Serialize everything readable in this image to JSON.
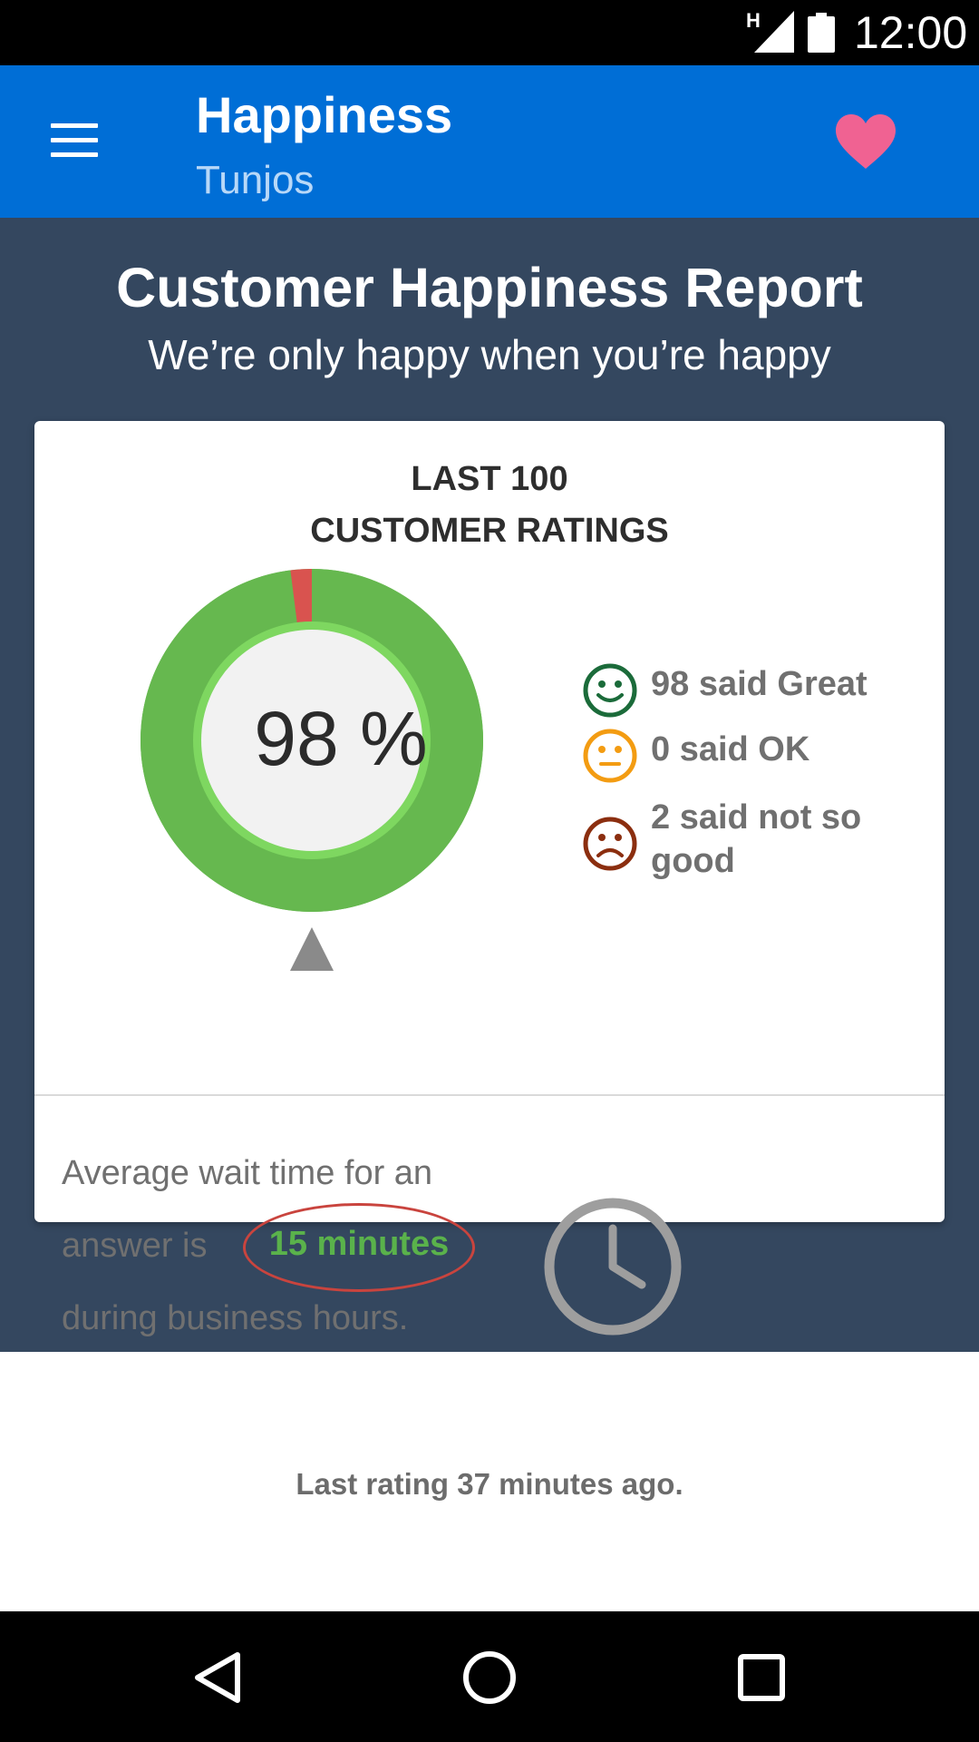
{
  "status_bar": {
    "network_type": "H",
    "time": "12:00",
    "icons": [
      "signal-icon",
      "battery-icon"
    ]
  },
  "app_bar": {
    "title": "Happiness",
    "subtitle": "Tunjos",
    "icons": [
      "menu-icon",
      "heart-icon"
    ],
    "heart_color": "#f06292"
  },
  "hero": {
    "title": "Customer Happiness Report",
    "subtitle": "We’re only happy when you’re happy"
  },
  "card": {
    "title_line1": "LAST 100",
    "title_line2": "CUSTOMER RATINGS",
    "percent_label": "98 %",
    "ratings": {
      "great": 98,
      "ok": 0,
      "not_so_good": 2
    },
    "legend": [
      {
        "icon": "happy-face-icon",
        "label": "98 said Great",
        "color": "#1b6b3a"
      },
      {
        "icon": "neutral-face-icon",
        "label": "0 said OK",
        "color": "#f39c12"
      },
      {
        "icon": "sad-face-icon",
        "label_line1": "2 said not so",
        "label_line2": "good",
        "color": "#8b2e0f"
      }
    ],
    "colors": {
      "great": "#66b84f",
      "not_so_good": "#d9534f",
      "inner_ring": "#7ed760"
    },
    "marker_icon": "triangle-up-icon"
  },
  "wait": {
    "line1": "Average wait time for an",
    "line2_prefix": "answer is",
    "highlight": "15 minutes",
    "line3": "during business hours.",
    "icon": "clock-icon"
  },
  "footer": {
    "last_rating": "Last rating 37 minutes ago."
  },
  "nav_bar": {
    "icons": [
      "back-icon",
      "home-icon",
      "recents-icon"
    ]
  }
}
